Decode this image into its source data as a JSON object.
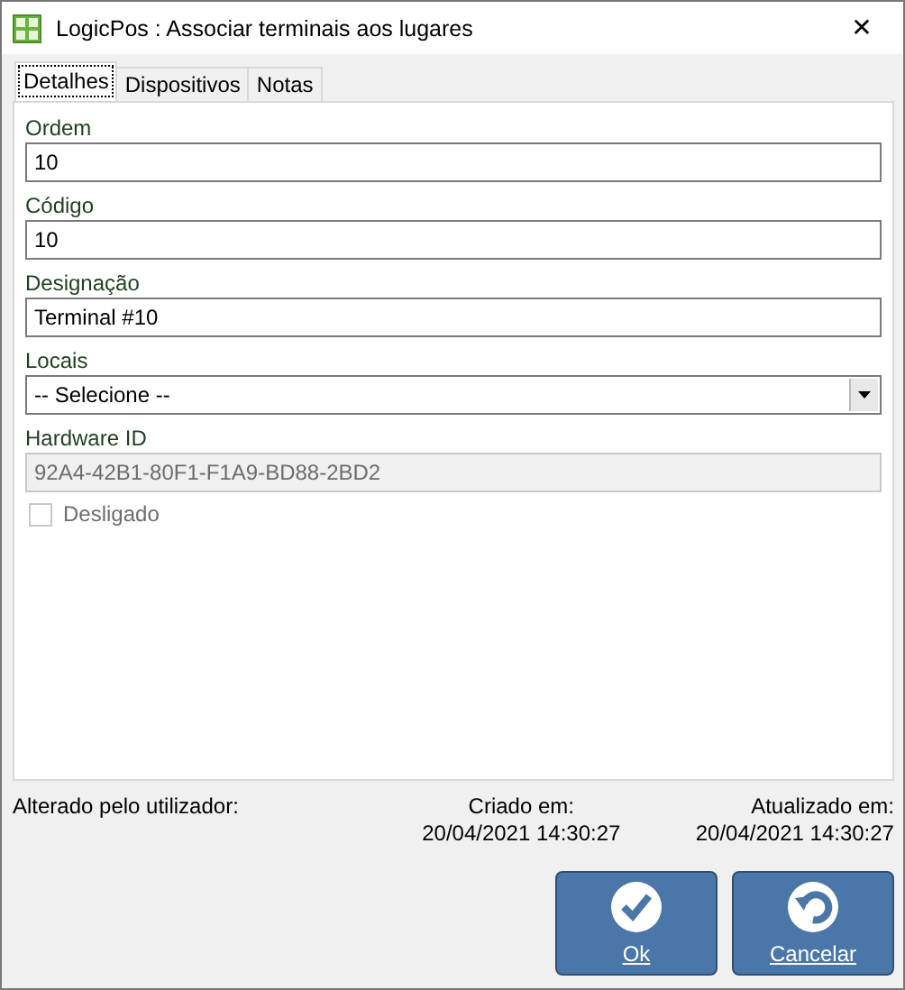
{
  "window": {
    "title": "LogicPos : Associar terminais aos lugares",
    "close": "✕"
  },
  "tabs": [
    {
      "label": "Detalhes",
      "selected": true
    },
    {
      "label": "Dispositivos",
      "selected": false
    },
    {
      "label": "Notas",
      "selected": false
    }
  ],
  "fields": [
    {
      "kind": "text",
      "label": "Ordem",
      "value": "10"
    },
    {
      "kind": "text",
      "label": "Código",
      "value": "10"
    },
    {
      "kind": "text",
      "label": "Designação",
      "value": "Terminal #10"
    },
    {
      "kind": "select",
      "label": "Locais",
      "value": "-- Selecione --"
    },
    {
      "kind": "text",
      "label": "Hardware ID",
      "value": "92A4-42B1-80F1-F1A9-BD88-2BD2",
      "disabled": true
    }
  ],
  "checkbox": {
    "label": "Desligado",
    "checked": false,
    "disabled": true
  },
  "footer": {
    "changed_by": "Alterado pelo utilizador:",
    "created_label": "Criado em:",
    "created": "20/04/2021 14:30:27",
    "updated_label": "Atualizado em:",
    "updated": "20/04/2021 14:30:27"
  },
  "buttons": [
    {
      "kind": "ok",
      "label": "Ok"
    },
    {
      "kind": "cancel",
      "label": "Cancelar"
    }
  ]
}
